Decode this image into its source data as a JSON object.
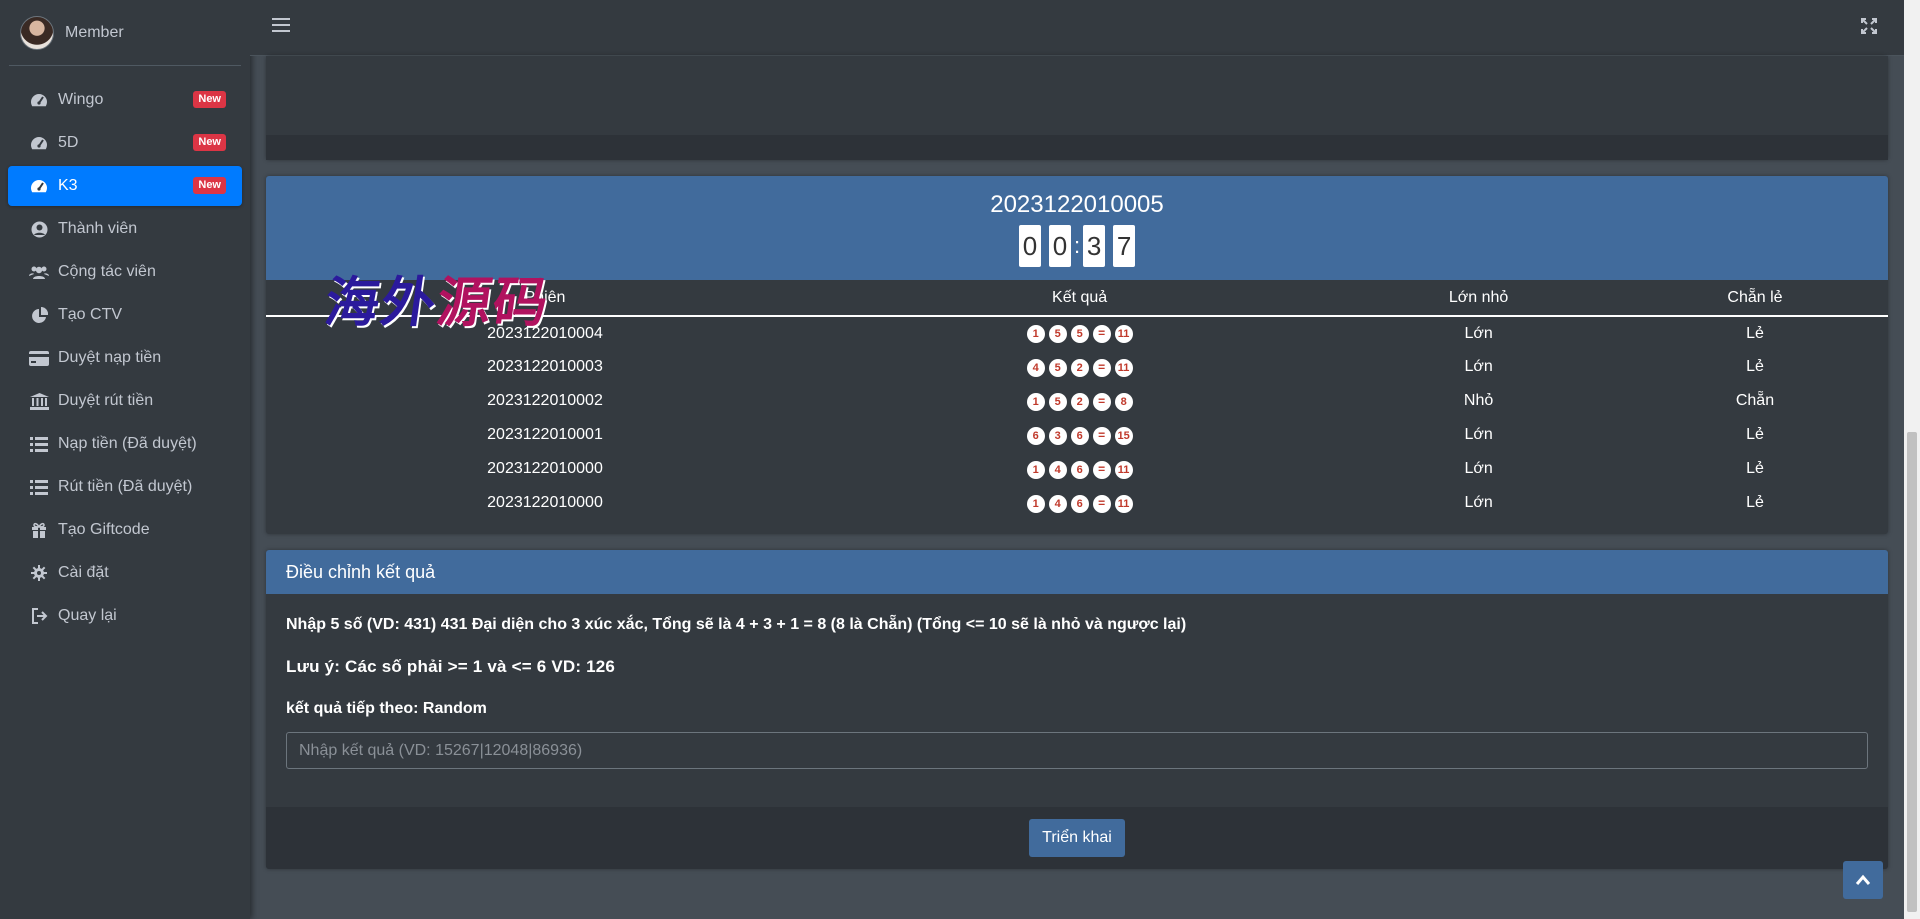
{
  "user": {
    "name": "Member"
  },
  "sidebar": {
    "items": [
      {
        "label": "Wingo",
        "icon": "tachometer-icon",
        "badge": "New"
      },
      {
        "label": "5D",
        "icon": "tachometer-icon",
        "badge": "New"
      },
      {
        "label": "K3",
        "icon": "tachometer-icon",
        "badge": "New",
        "active": true
      },
      {
        "label": "Thành viên",
        "icon": "user-circle-icon"
      },
      {
        "label": "Cộng tác viên",
        "icon": "users-icon"
      },
      {
        "label": "Tạo CTV",
        "icon": "pie-chart-icon"
      },
      {
        "label": "Duyệt nạp tiền",
        "icon": "credit-card-icon"
      },
      {
        "label": "Duyệt rút tiền",
        "icon": "bank-icon"
      },
      {
        "label": "Nạp tiền (Đã duyệt)",
        "icon": "list-icon"
      },
      {
        "label": "Rút tiền (Đã duyệt)",
        "icon": "list-icon"
      },
      {
        "label": "Tạo Giftcode",
        "icon": "gift-icon"
      },
      {
        "label": "Cài đặt",
        "icon": "gear-icon"
      },
      {
        "label": "Quay lại",
        "icon": "sign-out-icon"
      }
    ]
  },
  "round": {
    "id": "2023122010005",
    "timer": [
      "0",
      "0",
      "3",
      "7"
    ]
  },
  "table": {
    "headers": [
      "Phiên",
      "Kết quả",
      "Lớn nhỏ",
      "Chẵn lẻ"
    ],
    "rows": [
      {
        "session": "2023122010004",
        "dice": [
          "1",
          "5",
          "5"
        ],
        "total": "11",
        "size": "Lớn",
        "parity": "Lẻ"
      },
      {
        "session": "2023122010003",
        "dice": [
          "4",
          "5",
          "2"
        ],
        "total": "11",
        "size": "Lớn",
        "parity": "Lẻ"
      },
      {
        "session": "2023122010002",
        "dice": [
          "1",
          "5",
          "2"
        ],
        "total": "8",
        "size": "Nhỏ",
        "parity": "Chẵn"
      },
      {
        "session": "2023122010001",
        "dice": [
          "6",
          "3",
          "6"
        ],
        "total": "15",
        "size": "Lớn",
        "parity": "Lẻ"
      },
      {
        "session": "2023122010000",
        "dice": [
          "1",
          "4",
          "6"
        ],
        "total": "11",
        "size": "Lớn",
        "parity": "Lẻ"
      },
      {
        "session": "2023122010000",
        "dice": [
          "1",
          "4",
          "6"
        ],
        "total": "11",
        "size": "Lớn",
        "parity": "Lẻ"
      }
    ]
  },
  "watermark": {
    "part1": "海外",
    "part2": "源码"
  },
  "adjust": {
    "title": "Điều chỉnh kết quả",
    "instruction": "Nhập 5 số (VD: 431) 431 Đại diện cho 3 xúc xắc, Tổng sẽ là 4 + 3 + 1 = 8 (8 là Chẵn) (Tổng <= 10 sẽ là nhỏ và ngược lại)",
    "note": "Lưu ý: Các số phải >= 1 và <= 6 VD: 126",
    "next_label": "kết quả tiếp theo: Random",
    "input_placeholder": "Nhập kết quả (VD: 15267|12048|86936)",
    "input_value": "",
    "button_label": "Triển khai"
  }
}
